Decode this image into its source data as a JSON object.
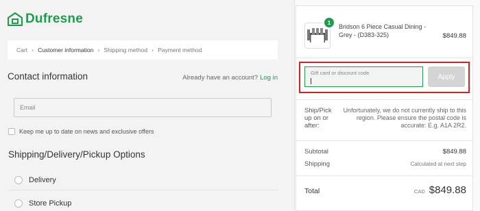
{
  "brand": {
    "name": "Dufresne",
    "color": "#1f9b4d"
  },
  "breadcrumb": [
    {
      "label": "Cart",
      "active": false
    },
    {
      "label": "Customer information",
      "active": true
    },
    {
      "label": "Shipping method",
      "active": false
    },
    {
      "label": "Payment method",
      "active": false
    }
  ],
  "contact": {
    "title": "Contact information",
    "account_prompt": "Already have an account?",
    "login_link": "Log in",
    "email_placeholder": "Email",
    "optin_label": "Keep me up to date on news and exclusive offers"
  },
  "shipping_options": {
    "title": "Shipping/Delivery/Pickup Options",
    "options": [
      "Delivery",
      "Store Pickup"
    ]
  },
  "order": {
    "product": {
      "name": "Bridson 6 Piece Casual Dining - Grey - (D383-325)",
      "price": "$849.88",
      "quantity": "1",
      "image": "dining-set-thumbnail"
    },
    "discount": {
      "placeholder": "Gift card or discount code",
      "apply_label": "Apply",
      "highlight_color": "#d81e1e"
    },
    "shipping_notice": {
      "label": "Ship/Pick up on or after:",
      "message": "Unfortunately, we do not currently ship to this region. Please ensure the postal code is accurate: E.g. A1A 2R2."
    },
    "subtotal_label": "Subtotal",
    "subtotal_value": "$849.88",
    "shipping_label": "Shipping",
    "shipping_value": "Calculated at next step",
    "total_label": "Total",
    "currency": "CAD",
    "total_value": "$849.88"
  }
}
